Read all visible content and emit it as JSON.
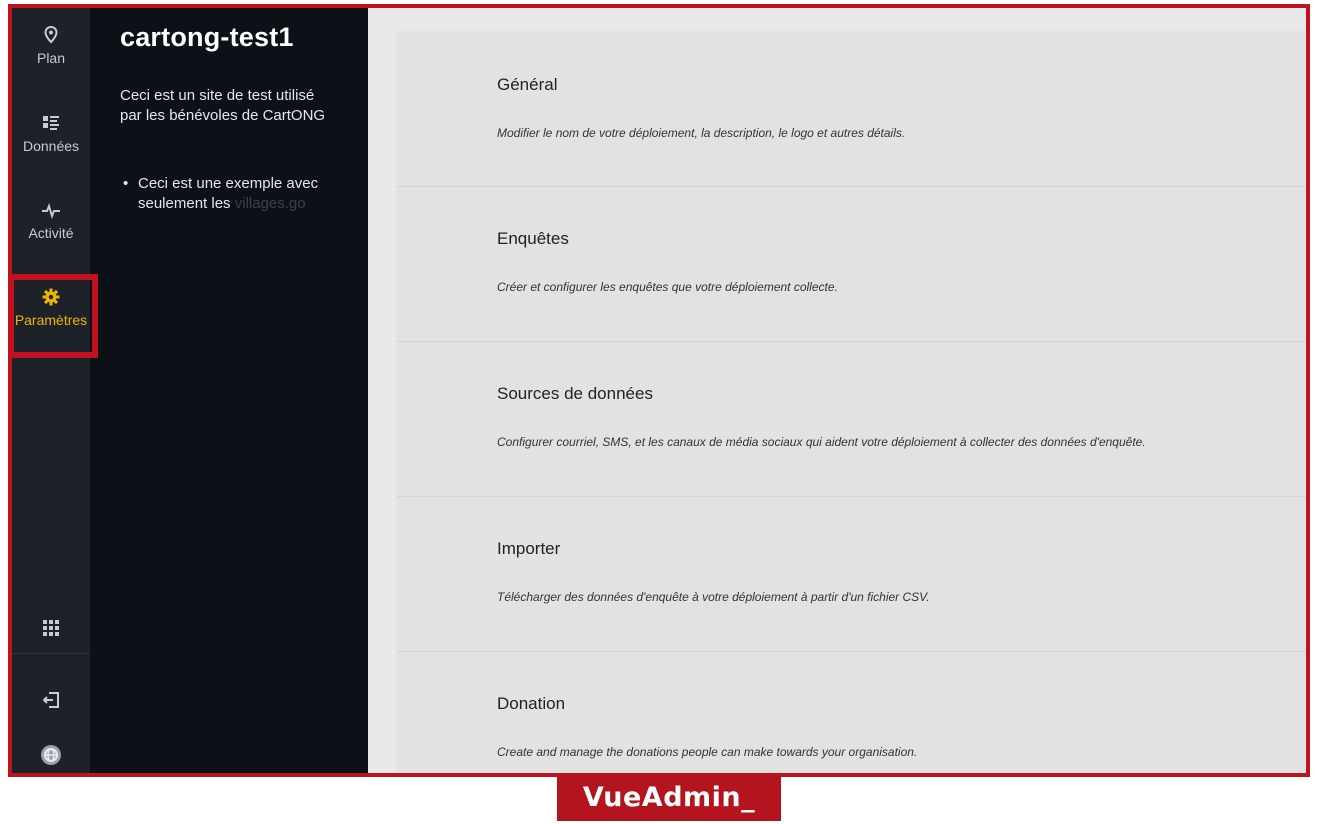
{
  "nav": {
    "items": [
      {
        "id": "plan",
        "label": "Plan",
        "icon": "map-pin-icon"
      },
      {
        "id": "donnees",
        "label": "Données",
        "icon": "data-list-icon"
      },
      {
        "id": "activite",
        "label": "Activité",
        "icon": "activity-icon"
      },
      {
        "id": "parametres",
        "label": "Paramètres",
        "icon": "gear-icon",
        "active": true
      }
    ],
    "bottom_icons": [
      "apps-grid-icon",
      "logout-icon",
      "globe-avatar-icon"
    ],
    "active_color": "#f0b400"
  },
  "site": {
    "title": "cartong-test1",
    "description": "Ceci est un site de test utilisé par les bénévoles de CartONG",
    "bullet": "Ceci est une exemple avec seulement les",
    "bullet_faded": "villages.go"
  },
  "settings": {
    "sections": [
      {
        "title": "Général",
        "description": "Modifier le nom de votre déploiement, la description, le logo et autres détails."
      },
      {
        "title": "Enquêtes",
        "description": "Créer et configurer les enquêtes que votre déploiement collecte."
      },
      {
        "title": "Sources de données",
        "description": "Configurer courriel, SMS, et les canaux de média sociaux qui aident votre déploiement à collecter des données d'enquête."
      },
      {
        "title": "Importer",
        "description": "Télécharger des données d'enquête à votre déploiement à partir d'un fichier CSV."
      },
      {
        "title": "Donation",
        "description": "Create and manage the donations people can make towards your organisation."
      }
    ]
  },
  "watermark": {
    "text": "VueAdmin_"
  },
  "colors": {
    "highlight": "#c1121f",
    "rail_bg": "#1d2228",
    "sidebar_bg": "#0c1117"
  }
}
